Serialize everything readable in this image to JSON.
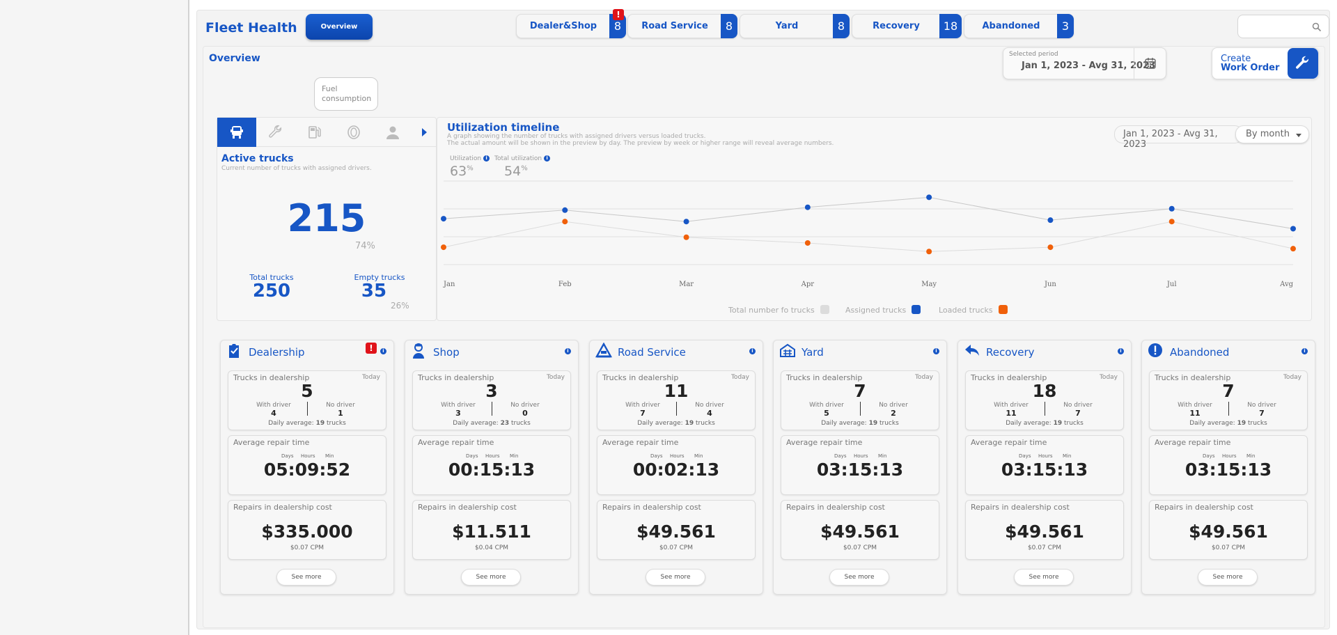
{
  "header": {
    "title": "Fleet Health",
    "overview_button": "Overview",
    "tabs": [
      {
        "label": "Dealer&Shop",
        "count": "8",
        "alert": "!"
      },
      {
        "label": "Road Service",
        "count": "8"
      },
      {
        "label": "Yard",
        "count": "8"
      },
      {
        "label": "Recovery",
        "count": "18"
      },
      {
        "label": "Abandoned",
        "count": "3"
      }
    ],
    "search_icon": "search-icon"
  },
  "overview": {
    "title": "Overview",
    "period_label": "Selected period",
    "period_value": "Jan 1, 2023 - Avg 31, 2023",
    "create_label": "Create",
    "work_order_label": "Work Order"
  },
  "tooltip": {
    "text": "Fuel consumption"
  },
  "active_trucks": {
    "title": "Active trucks",
    "subtitle": "Current number of trucks with assigned drivers.",
    "value": "215",
    "percent": "74%",
    "total_label": "Total trucks",
    "total_value": "250",
    "empty_label": "Empty trucks",
    "empty_value": "35",
    "empty_percent": "26%"
  },
  "timeline": {
    "title": "Utilization timeline",
    "subtitle1": "A graph showing the number of trucks with assigned drivers versus loaded trucks.",
    "subtitle2": "The actual amount will be shown in the preview by day. The preview by week or higher range will reveal average numbers.",
    "range": "Jan 1, 2023 - Avg 31, 2023",
    "grouping": "By month",
    "utilization_label": "Utilization",
    "utilization_value": "63",
    "total_utilization_label": "Total utilization",
    "total_utilization_value": "54",
    "percent_sign": "%",
    "legend_total": "Total number fo trucks",
    "legend_assigned": "Assigned trucks",
    "legend_loaded": "Loaded trucks",
    "colors": {
      "assigned": "#1756c5",
      "loaded": "#f0600a",
      "total": "#dcdcdc"
    }
  },
  "chart_data": {
    "type": "line",
    "categories": [
      "Jan",
      "Feb",
      "Mar",
      "Apr",
      "May",
      "Jun",
      "Jul",
      "Avg"
    ],
    "series": [
      {
        "name": "Assigned trucks",
        "values": [
          78,
          84,
          76,
          86,
          93,
          77,
          85,
          71
        ]
      },
      {
        "name": "Loaded trucks",
        "values": [
          58,
          76,
          65,
          61,
          55,
          58,
          76,
          57
        ]
      }
    ],
    "ylim": [
      0,
      100
    ],
    "grid": true
  },
  "cards": [
    {
      "title": "Dealership",
      "icon": "clipboard-icon",
      "alert": "!",
      "trucks_label": "Trucks in dealership",
      "today": "Today",
      "trucks": "5",
      "with_driver_label": "With driver",
      "with_driver": "4",
      "no_driver_label": "No driver",
      "no_driver": "1",
      "daily_avg_label": "Daily average:",
      "daily_avg": "19",
      "trucks_word": "trucks",
      "repair_label": "Average repair time",
      "days": "Days",
      "hours": "Hours",
      "min": "Min",
      "repair_time": "05:09:52",
      "cost_label": "Repairs in dealership cost",
      "cost": "$335.000",
      "cpm": "$0.07 CPM",
      "see_more": "See more"
    },
    {
      "title": "Shop",
      "icon": "mechanic-icon",
      "trucks_label": "Trucks in dealership",
      "today": "Today",
      "trucks": "3",
      "with_driver_label": "With driver",
      "with_driver": "3",
      "no_driver_label": "No driver",
      "no_driver": "0",
      "daily_avg_label": "Daily average:",
      "daily_avg": "23",
      "trucks_word": "trucks",
      "repair_label": "Average repair time",
      "days": "Days",
      "hours": "Hours",
      "min": "Min",
      "repair_time": "00:15:13",
      "cost_label": "Repairs in dealership cost",
      "cost": "$11.511",
      "cpm": "$0.04 CPM",
      "see_more": "See more"
    },
    {
      "title": "Road Service",
      "icon": "road-icon",
      "trucks_label": "Trucks in dealership",
      "today": "Today",
      "trucks": "11",
      "with_driver_label": "With driver",
      "with_driver": "7",
      "no_driver_label": "No driver",
      "no_driver": "4",
      "daily_avg_label": "Daily average:",
      "daily_avg": "19",
      "trucks_word": "trucks",
      "repair_label": "Average repair time",
      "days": "Days",
      "hours": "Hours",
      "min": "Min",
      "repair_time": "00:02:13",
      "cost_label": "Repairs in dealership cost",
      "cost": "$49.561",
      "cpm": "$0.07 CPM",
      "see_more": "See more"
    },
    {
      "title": "Yard",
      "icon": "yard-icon",
      "trucks_label": "Trucks in dealership",
      "today": "Today",
      "trucks": "7",
      "with_driver_label": "With driver",
      "with_driver": "5",
      "no_driver_label": "No driver",
      "no_driver": "2",
      "daily_avg_label": "Daily average:",
      "daily_avg": "19",
      "trucks_word": "trucks",
      "repair_label": "Average repair time",
      "days": "Days",
      "hours": "Hours",
      "min": "Min",
      "repair_time": "03:15:13",
      "cost_label": "Repairs in dealership cost",
      "cost": "$49.561",
      "cpm": "$0.07 CPM",
      "see_more": "See more"
    },
    {
      "title": "Recovery",
      "icon": "reply-arrow-icon",
      "trucks_label": "Trucks in dealership",
      "today": "Today",
      "trucks": "18",
      "with_driver_label": "With driver",
      "with_driver": "11",
      "no_driver_label": "No driver",
      "no_driver": "7",
      "daily_avg_label": "Daily average:",
      "daily_avg": "19",
      "trucks_word": "trucks",
      "repair_label": "Average repair time",
      "days": "Days",
      "hours": "Hours",
      "min": "Min",
      "repair_time": "03:15:13",
      "cost_label": "Repairs in dealership cost",
      "cost": "$49.561",
      "cpm": "$0.07 CPM",
      "see_more": "See more"
    },
    {
      "title": "Abandoned",
      "icon": "exclamation-circle-icon",
      "trucks_label": "Trucks in dealership",
      "today": "Today",
      "trucks": "7",
      "with_driver_label": "With driver",
      "with_driver": "11",
      "no_driver_label": "No driver",
      "no_driver": "7",
      "daily_avg_label": "Daily average:",
      "daily_avg": "19",
      "trucks_word": "trucks",
      "repair_label": "Average repair time",
      "days": "Days",
      "hours": "Hours",
      "min": "Min",
      "repair_time": "03:15:13",
      "cost_label": "Repairs in dealership cost",
      "cost": "$49.561",
      "cpm": "$0.07 CPM",
      "see_more": "See more"
    }
  ]
}
